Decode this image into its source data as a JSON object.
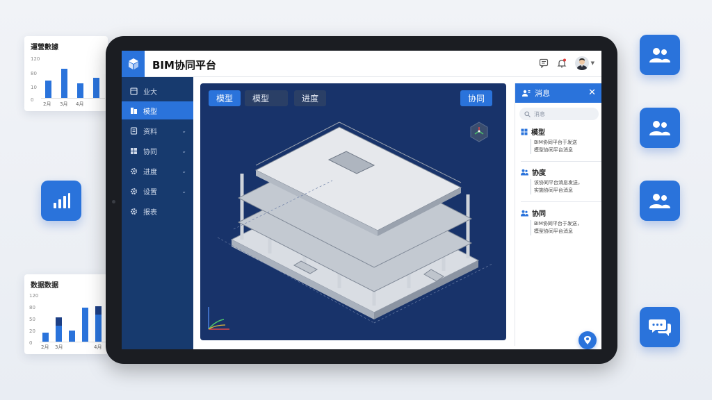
{
  "chart_cards": [
    {
      "title": "運營數據",
      "chart_data": {
        "type": "bar",
        "categories": [
          "2月",
          "3月",
          "4月",
          ""
        ],
        "series": [
          {
            "values": [
              35,
              60,
              30,
              42
            ]
          }
        ],
        "y_ticks": [
          "120",
          "80",
          "10",
          "0"
        ],
        "color": "#2a73db"
      }
    },
    {
      "title": "数据数据",
      "chart_data": {
        "type": "bar",
        "categories": [
          "2月",
          "3月",
          "",
          "4月"
        ],
        "series": [
          {
            "values": [
              20,
              35,
              25,
              75,
              60
            ],
            "color": "#2a73db"
          },
          {
            "values": [
              0,
              18,
              0,
              0,
              18
            ],
            "color": "#1d3f85"
          }
        ],
        "y_ticks": [
          "120",
          "80",
          "50",
          "20",
          "0"
        ]
      }
    }
  ],
  "side_tiles": [
    {
      "icon": "users-icon"
    },
    {
      "icon": "users-icon"
    },
    {
      "icon": "users-icon"
    },
    {
      "icon": "chat-bubbles-icon"
    }
  ],
  "left_tile": {
    "icon": "bar-chart-icon"
  },
  "app": {
    "title": "BIM协同平台",
    "logo_icon": "cube-logo-icon",
    "top_icons": [
      "message-icon",
      "bell-icon",
      "avatar"
    ]
  },
  "sidebar": {
    "items": [
      {
        "label": "业大",
        "icon": "dashboard-icon",
        "active": false,
        "has_chevron": false
      },
      {
        "label": "模型",
        "icon": "model-icon",
        "active": true,
        "has_chevron": false
      },
      {
        "label": "资料",
        "icon": "document-icon",
        "active": false,
        "has_chevron": true
      },
      {
        "label": "协同",
        "icon": "grid-icon",
        "active": false,
        "has_chevron": true
      },
      {
        "label": "进度",
        "icon": "gear-icon",
        "active": false,
        "has_chevron": true
      },
      {
        "label": "设置",
        "icon": "gear-icon",
        "active": false,
        "has_chevron": true
      },
      {
        "label": "报表",
        "icon": "gear-icon",
        "active": false,
        "has_chevron": false
      }
    ]
  },
  "viewport": {
    "tabs": [
      "模型",
      "模型",
      "进度"
    ],
    "collab_button": "协同",
    "view_cube_icon": "view-cube-icon",
    "axis_icon": "axis-gizmo-icon",
    "model_icon": "building-model"
  },
  "messages_panel": {
    "title": "消息",
    "search_placeholder": "消息",
    "items": [
      {
        "title": "模型",
        "icon": "grid-icon",
        "line1": "BIM协同平台于发送",
        "line2": "模型协同平台消息"
      },
      {
        "title": "协度",
        "icon": "users-icon",
        "line1": "该协同平台消息发送，",
        "line2": "实施协同平台消息"
      },
      {
        "title": "协同",
        "icon": "users-icon",
        "line1": "BIM协同平台于发送，",
        "line2": "模型协同平台消息"
      }
    ],
    "fab_icon": "location-pin-icon"
  },
  "colors": {
    "accent": "#2a73db",
    "sidebar": "#173a6e",
    "viewport": "#18336a"
  }
}
